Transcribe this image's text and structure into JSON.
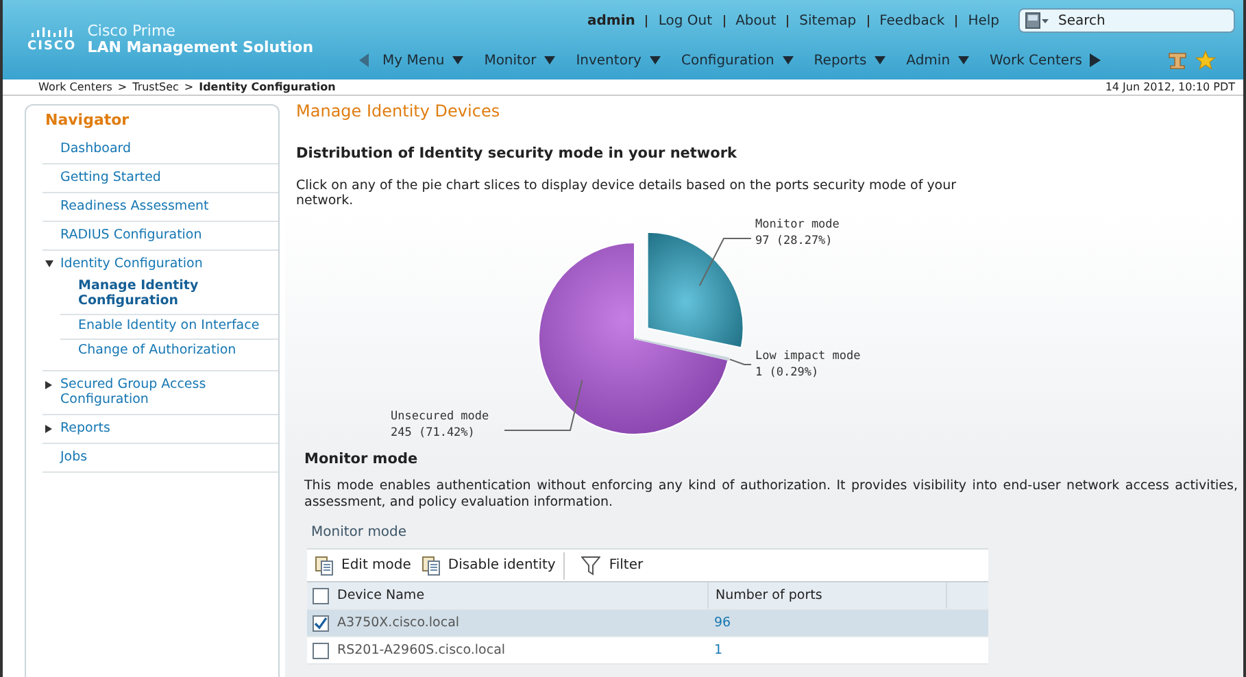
{
  "header": {
    "logo_text": "CISCO",
    "product": "Cisco Prime",
    "product_name": "LAN Management Solution",
    "user": "admin",
    "links": [
      "Log Out",
      "About",
      "Sitemap",
      "Feedback",
      "Help"
    ],
    "search": {
      "placeholder": "Search"
    },
    "menu": [
      "My Menu",
      "Monitor",
      "Inventory",
      "Configuration",
      "Reports",
      "Admin",
      "Work Centers"
    ]
  },
  "breadcrumb": {
    "items": [
      "Work Centers",
      "TrustSec"
    ],
    "separator": ">",
    "current": "Identity Configuration",
    "timestamp": "14 Jun 2012, 10:10 PDT"
  },
  "navigator": {
    "title": "Navigator",
    "items": [
      {
        "label": "Dashboard",
        "kind": "link"
      },
      {
        "label": "Getting Started",
        "kind": "link"
      },
      {
        "label": "Readiness Assessment",
        "kind": "link"
      },
      {
        "label": "RADIUS Configuration",
        "kind": "link"
      },
      {
        "label": "Identity Configuration",
        "kind": "group",
        "expanded": true,
        "children": [
          {
            "label": "Manage Identity Configuration",
            "selected": true
          },
          {
            "label": "Enable Identity on Interface",
            "selected": false
          },
          {
            "label": "Change of Authorization",
            "selected": false
          }
        ]
      },
      {
        "label": "Secured Group Access Configuration",
        "kind": "group",
        "expanded": false
      },
      {
        "label": "Reports",
        "kind": "group",
        "expanded": false
      },
      {
        "label": "Jobs",
        "kind": "link"
      }
    ]
  },
  "main": {
    "title": "Manage Identity Devices",
    "chart_section": {
      "heading": "Distribution of Identity security mode in your network",
      "description": "Click on any of the pie chart slices to display device details based on the ports security mode of your network.",
      "chart_data": {
        "type": "pie",
        "categories": [
          "Monitor mode",
          "Low impact mode",
          "Unsecured mode"
        ],
        "values": [
          97,
          1,
          245
        ],
        "value_labels": [
          "97 (28.27%)",
          "1 (0.29%)",
          "245 (71.42%)"
        ]
      }
    },
    "mode_section": {
      "heading": "Monitor mode",
      "description": "This mode enables authentication without enforcing any kind of authorization. It provides visibility into end-user network access activities, assessment, and policy evaluation information.",
      "table_title": "Monitor mode",
      "toolbar": [
        "Edit mode",
        "Disable identity",
        "Filter"
      ],
      "columns": [
        "Device Name",
        "Number of ports"
      ],
      "header_checked": false,
      "rows": [
        {
          "device": "A3750X.cisco.local",
          "ports": "96",
          "checked": true,
          "selected": true
        },
        {
          "device": "RS201-A2960S.cisco.local",
          "ports": "1",
          "checked": false,
          "selected": false
        }
      ]
    }
  }
}
